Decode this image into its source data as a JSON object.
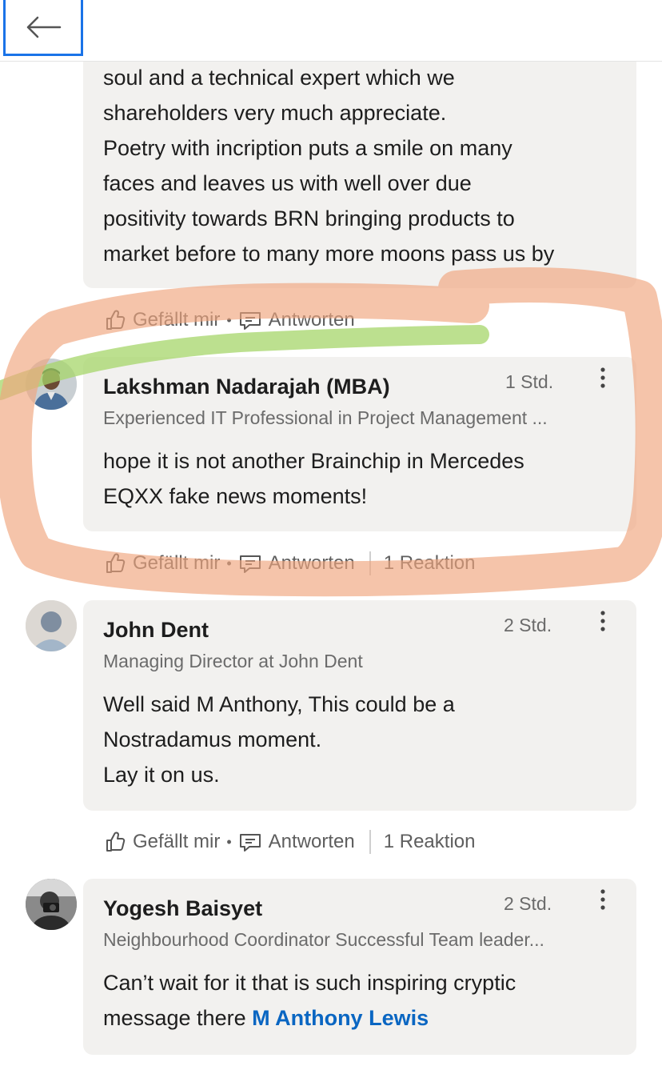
{
  "header": {
    "back_icon": "arrow-left-icon"
  },
  "comments": [
    {
      "continued_text": [
        "soul and a technical expert which we",
        "shareholders very much appreciate.",
        "Poetry with incription puts a smile on many",
        "faces and  leaves us with well over due",
        "positivity towards BRN bringing products to",
        "market before to many more moons pass us by"
      ],
      "actions": {
        "like": "Gefällt mir",
        "reply": "Antworten"
      }
    },
    {
      "name": "Lakshman Nadarajah (MBA)",
      "headline": "Experienced IT Professional in Project Management ...",
      "time": "1 Std.",
      "text": [
        "hope it is not another Brainchip in Mercedes",
        "EQXX fake news moments!"
      ],
      "actions": {
        "like": "Gefällt mir",
        "reply": "Antworten",
        "reactions": "1 Reaktion"
      }
    },
    {
      "name": "John Dent",
      "headline": "Managing Director at John Dent",
      "time": "2 Std.",
      "text": [
        "Well said M Anthony, This could be a",
        "Nostradamus moment.",
        "Lay it on us."
      ],
      "actions": {
        "like": "Gefällt mir",
        "reply": "Antworten",
        "reactions": "1 Reaktion"
      }
    },
    {
      "name": "Yogesh Baisyet",
      "headline": "Neighbourhood Coordinator Successful Team leader...",
      "time": "2 Std.",
      "text_line1": "Can’t wait for it that is such inspiring  cryptic",
      "text_line2_prefix": "message there ",
      "mention": "M Anthony Lewis"
    }
  ],
  "colors": {
    "accent_blue": "#0a66c2",
    "focus_blue": "#1a73e8",
    "bubble_bg": "#f2f1ef",
    "highlight_orange": "#f0a47c",
    "highlight_green": "#a6d66a"
  }
}
